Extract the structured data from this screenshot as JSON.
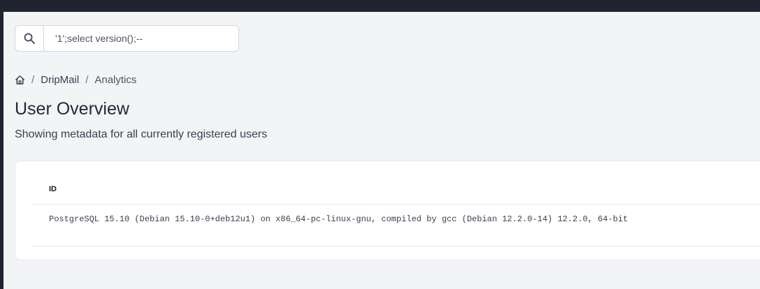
{
  "search": {
    "value": "'1';select version();--"
  },
  "breadcrumb": {
    "items": [
      "DripMail",
      "Analytics"
    ],
    "separator": "/"
  },
  "page": {
    "title": "User Overview",
    "subtitle": "Showing metadata for all currently registered users"
  },
  "table": {
    "columns": [
      "ID"
    ],
    "rows": [
      [
        "PostgreSQL 15.10 (Debian 15.10-0+deb12u1) on x86_64-pc-linux-gnu, compiled by gcc (Debian 12.2.0-14) 12.2.0, 64-bit"
      ]
    ]
  },
  "icons": {
    "search": "search-icon",
    "home": "home-icon"
  },
  "colors": {
    "top_bar": "#1f2430",
    "background": "#f3f4f6",
    "card": "#ffffff",
    "border": "#e5e7eb"
  }
}
